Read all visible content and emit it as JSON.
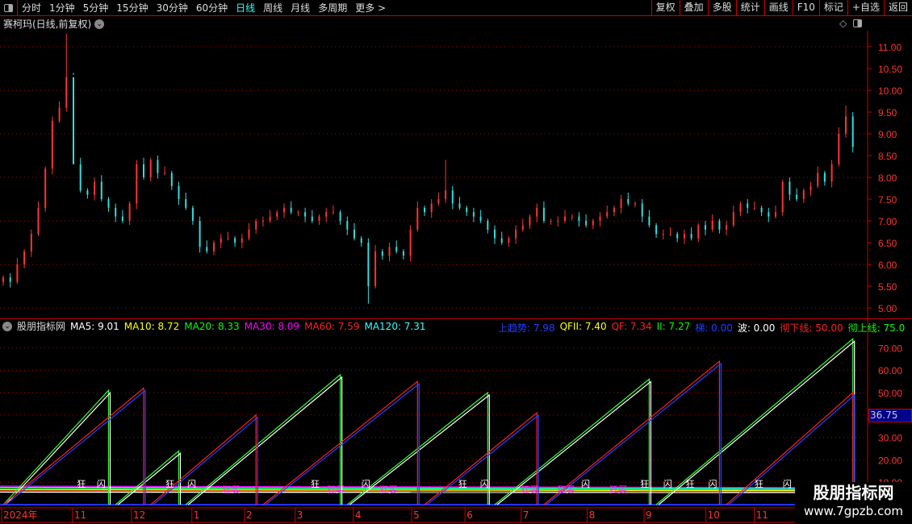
{
  "toolbar": {
    "tabs": [
      "分时",
      "1分钟",
      "5分钟",
      "15分钟",
      "30分钟",
      "60分钟",
      "日线",
      "周线",
      "月线",
      "多周期",
      "更多 >"
    ],
    "active": "日线",
    "right": [
      "复权",
      "叠加",
      "多股",
      "统计",
      "画线",
      "F10",
      "标记",
      "+自选",
      "返回"
    ]
  },
  "title": "赛柯玛(日线,前复权)",
  "main": {
    "yticks": [
      "11.00",
      "10.50",
      "10.00",
      "9.50",
      "9.00",
      "8.50",
      "8.00",
      "7.50",
      "7.00",
      "6.50",
      "6.00",
      "5.50",
      "5.00"
    ],
    "closes": [
      5.7,
      5.6,
      6.0,
      6.3,
      6.7,
      7.3,
      8.2,
      9.3,
      9.6,
      10.3,
      8.3,
      7.7,
      7.6,
      7.9,
      7.5,
      7.3,
      7.1,
      7.0,
      7.4,
      8.3,
      8.0,
      8.4,
      8.1,
      8.1,
      7.8,
      7.5,
      7.3,
      7.0,
      6.4,
      6.3,
      6.5,
      6.6,
      6.6,
      6.5,
      6.6,
      6.8,
      7.0,
      7.0,
      7.1,
      7.2,
      7.3,
      7.2,
      7.2,
      7.1,
      7.0,
      7.1,
      7.2,
      7.2,
      7.0,
      6.8,
      6.6,
      6.5,
      5.5,
      6.3,
      6.2,
      6.4,
      6.3,
      6.2,
      6.8,
      7.3,
      7.2,
      7.4,
      7.5,
      7.7,
      7.4,
      7.3,
      7.2,
      7.1,
      7.0,
      6.8,
      6.6,
      6.5,
      6.6,
      6.8,
      6.9,
      7.1,
      7.3,
      7.0,
      7.0,
      7.0,
      7.1,
      7.1,
      7.0,
      6.9,
      7.0,
      7.1,
      7.2,
      7.3,
      7.5,
      7.4,
      7.4,
      7.1,
      6.9,
      6.7,
      6.7,
      6.7,
      6.6,
      6.7,
      6.6,
      6.9,
      6.8,
      7.0,
      6.8,
      6.9,
      7.2,
      7.4,
      7.3,
      7.3,
      7.2,
      7.1,
      7.2,
      7.9,
      7.6,
      7.5,
      7.7,
      7.8,
      8.1,
      7.9,
      8.3,
      9.0,
      9.4,
      8.7
    ],
    "high_overrides": {
      "9": 11.3,
      "10": 10.35,
      "52": 5.1,
      "63": 8.4,
      "120": 9.65
    },
    "colors": {
      "up": "#ff3333",
      "down": "#33dddd"
    }
  },
  "indicator": {
    "name": "股朋指标网",
    "ma": [
      {
        "label": "MA5: 9.01",
        "color": "#ffffff"
      },
      {
        "label": "MA10: 8.72",
        "color": "#ffff00"
      },
      {
        "label": "MA20: 8.33",
        "color": "#00ff00"
      },
      {
        "label": "MA30: 8.09",
        "color": "#ff00ff"
      },
      {
        "label": "MA60: 7.59",
        "color": "#ff2020"
      },
      {
        "label": "MA120: 7.31",
        "color": "#33ffff"
      }
    ],
    "values": [
      {
        "label": "上趋势: 7.98",
        "color": "#2040ff"
      },
      {
        "label": "QFII: 7.40",
        "color": "#ffff00"
      },
      {
        "label": "QF: 7.34",
        "color": "#ff2020"
      },
      {
        "label": "II: 7.27",
        "color": "#00ff00"
      },
      {
        "label": "梯: 0.00",
        "color": "#2040ff"
      },
      {
        "label": "波: 0.00",
        "color": "#ffffff"
      },
      {
        "label": "彻下线: 50.00",
        "color": "#ff2020"
      },
      {
        "label": "彻上线: 75.0",
        "color": "#00ff00"
      }
    ],
    "yticks": [
      "70.00",
      "60.00",
      "50.00",
      "40.00",
      "30.00",
      "20.00",
      "10.00"
    ],
    "current": "36.75",
    "upper_saw": [
      [
        0,
        15,
        51
      ],
      [
        16,
        25,
        24
      ],
      [
        26,
        48,
        58
      ],
      [
        49,
        69,
        50
      ],
      [
        70,
        92,
        56
      ],
      [
        93,
        121,
        74
      ]
    ],
    "lower_saw": [
      [
        0,
        20,
        52
      ],
      [
        21,
        36,
        40
      ],
      [
        37,
        59,
        55
      ],
      [
        60,
        76,
        41
      ],
      [
        77,
        102,
        64
      ],
      [
        103,
        121,
        50
      ]
    ],
    "signals": [
      {
        "t": "狂",
        "i": 10.5,
        "c": "#ffffff"
      },
      {
        "t": "闪",
        "i": 13.3,
        "c": "#ffffff"
      },
      {
        "t": "狂",
        "i": 23.1,
        "c": "#ffffff"
      },
      {
        "t": "闪",
        "i": 26.2,
        "c": "#ffffff"
      },
      {
        "t": "狂买",
        "i": 31.2,
        "c": "#ff33ff"
      },
      {
        "t": "狂",
        "i": 43.8,
        "c": "#ffffff"
      },
      {
        "t": "狂买",
        "i": 46.1,
        "c": "#ff33ff"
      },
      {
        "t": "闪",
        "i": 51,
        "c": "#ffffff"
      },
      {
        "t": "狂买",
        "i": 53.6,
        "c": "#ff33ff"
      },
      {
        "t": "狂",
        "i": 64.8,
        "c": "#ffffff"
      },
      {
        "t": "闪",
        "i": 67.9,
        "c": "#ffffff"
      },
      {
        "t": "狂买",
        "i": 73.7,
        "c": "#ff33ff"
      },
      {
        "t": "狂买",
        "i": 78.9,
        "c": "#ff33ff"
      },
      {
        "t": "闪",
        "i": 82.3,
        "c": "#ffffff"
      },
      {
        "t": "狂买",
        "i": 86.3,
        "c": "#ff33ff"
      },
      {
        "t": "狂",
        "i": 90.7,
        "c": "#ffffff"
      },
      {
        "t": "闪",
        "i": 94,
        "c": "#ffffff"
      },
      {
        "t": "狂",
        "i": 97.2,
        "c": "#ffffff"
      },
      {
        "t": "闪",
        "i": 100.4,
        "c": "#ffffff"
      },
      {
        "t": "狂",
        "i": 107,
        "c": "#ffffff"
      },
      {
        "t": "闪",
        "i": 111,
        "c": "#ffffff"
      }
    ]
  },
  "dates": [
    {
      "t": "2024年",
      "i": 0
    },
    {
      "t": "11",
      "i": 10.1
    },
    {
      "t": "12",
      "i": 18.5
    },
    {
      "t": "1",
      "i": 27.1
    },
    {
      "t": "2",
      "i": 34.6
    },
    {
      "t": "3",
      "i": 41.8
    },
    {
      "t": "4",
      "i": 50.1
    },
    {
      "t": "5",
      "i": 58.4
    },
    {
      "t": "6",
      "i": 66
    },
    {
      "t": "7",
      "i": 74
    },
    {
      "t": "8",
      "i": 83.4
    },
    {
      "t": "9",
      "i": 91.5
    },
    {
      "t": "10",
      "i": 100.3
    },
    {
      "t": "11",
      "i": 107.2
    }
  ],
  "watermark": {
    "name": "股朋指标网",
    "url": "www.7gpzb.com"
  }
}
